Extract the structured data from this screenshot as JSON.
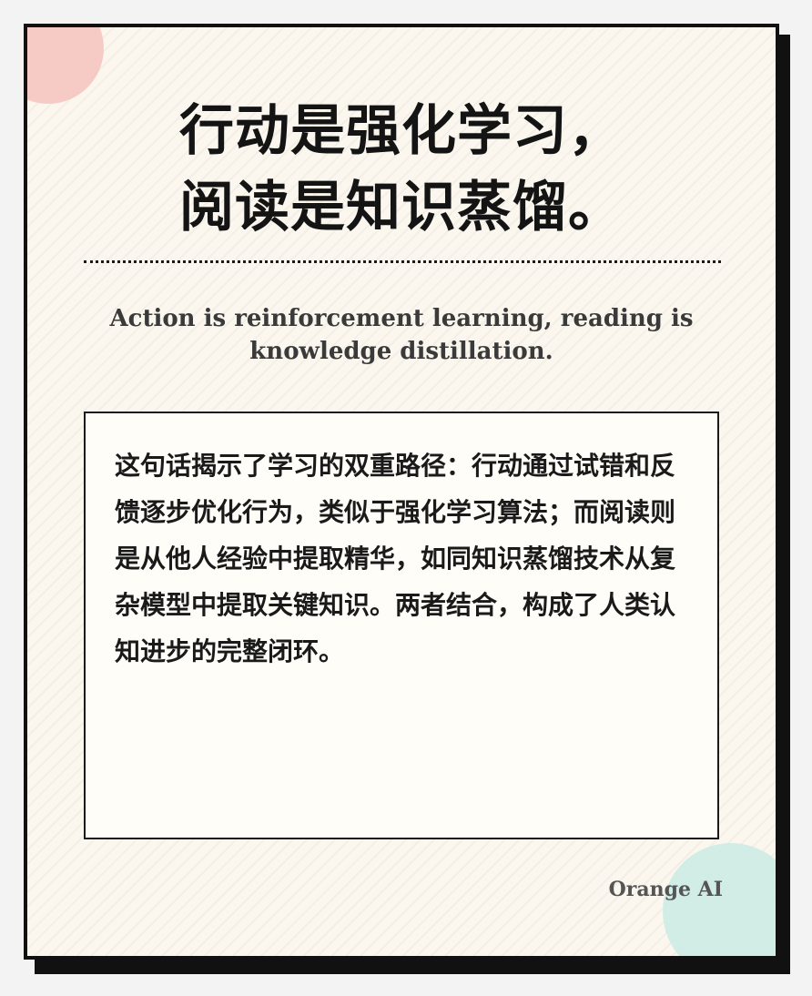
{
  "title": {
    "line1": "行动是强化学习，",
    "line2": "阅读是知识蒸馏。"
  },
  "subtitle": "Action is reinforcement learning, reading is knowledge distillation.",
  "body": "这句话揭示了学习的双重路径：行动通过试错和反馈逐步优化行为，类似于强化学习算法；而阅读则是从他人经验中提取精华，如同知识蒸馏技术从复杂模型中提取关键知识。两者结合，构成了人类认知进步的完整闭环。",
  "brand": "Orange AI",
  "colors": {
    "background": "#f3f3f3",
    "card": "#fbf7ee",
    "border": "#111111",
    "accent_pink": "#f6c3bd",
    "accent_green": "#c9ebe3"
  }
}
